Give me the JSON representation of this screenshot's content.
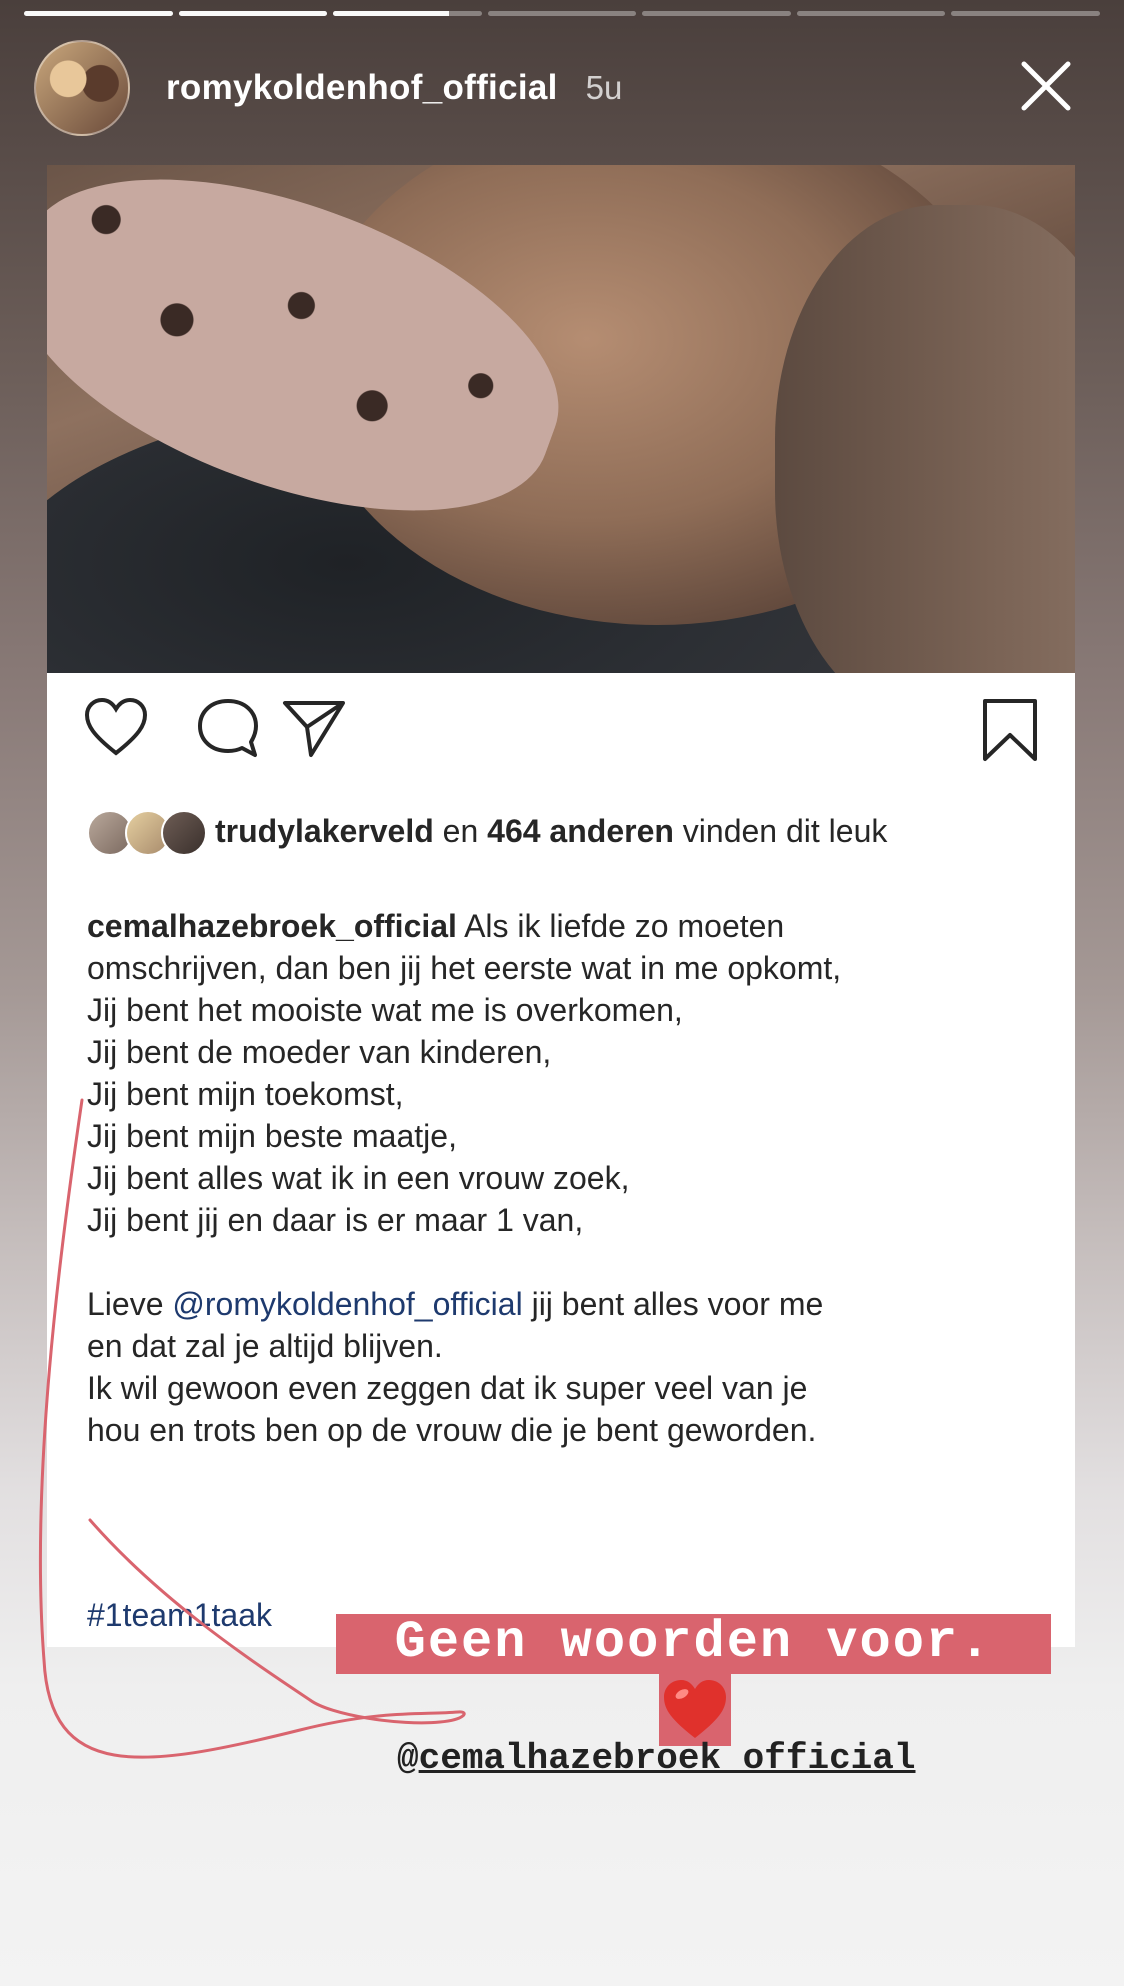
{
  "story": {
    "progress_segments": [
      1,
      1,
      0.78,
      0,
      0,
      0,
      0
    ],
    "username": "romykoldenhof_official",
    "time": "5u",
    "close_icon": "close-icon"
  },
  "post": {
    "likes_user": "trudylakerveld",
    "likes_en": " en ",
    "likes_count": "464 anderen",
    "likes_rest": " vinden dit leuk",
    "caption_user": "cemalhazebroek_official",
    "caption_line1": " Als ik liefde zo moeten",
    "caption_lines": [
      "omschrijven, dan ben jij het eerste wat in me opkomt,",
      "Jij bent het mooiste wat me is overkomen,",
      "Jij bent de moeder van kinderen,",
      "Jij bent mijn toekomst,",
      "Jij bent mijn beste maatje,",
      "Jij bent alles wat ik in een vrouw zoek,",
      "Jij bent jij en daar is er maar 1 van,"
    ],
    "lieve": "Lieve ",
    "mention": "@romykoldenhof_official",
    "lieve_rest": " jij bent alles voor me",
    "lines2": [
      "en dat zal je altijd blijven.",
      "Ik wil gewoon even zeggen dat ik super veel van je",
      "hou en trots ben op de vrouw die je bent geworden."
    ],
    "hashtag": "#1team1taak"
  },
  "overlay": {
    "sticker_text": "Geen woorden voor.",
    "heart": "❤️",
    "tag_at": "@",
    "tag_user": "cemalhazebroek_official",
    "accent": "#d9646e"
  }
}
